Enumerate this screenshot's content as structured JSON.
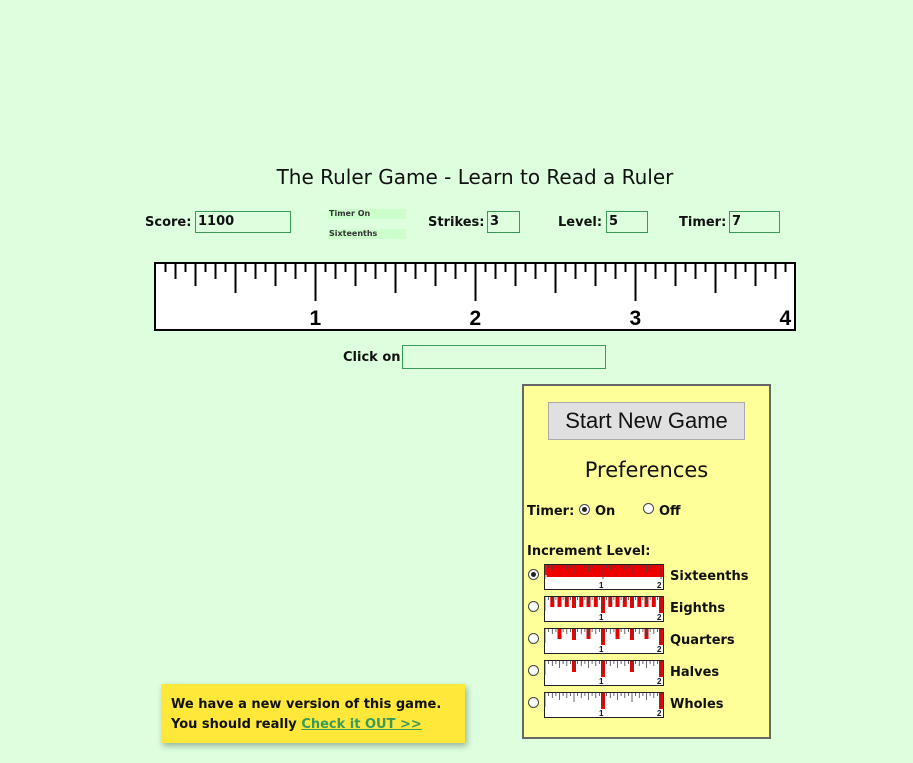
{
  "title": "The Ruler Game - Learn to Read a Ruler",
  "stats": {
    "score_label": "Score:",
    "score_value": "1100",
    "status_timer": "Timer On",
    "status_level": "Sixteenths",
    "strikes_label": "Strikes:",
    "strikes_value": "3",
    "level_label": "Level:",
    "level_value": "5",
    "timer_label": "Timer:",
    "timer_value": "7"
  },
  "ruler": {
    "inches": 4,
    "subdivisions_per_inch": 16,
    "labels": [
      "1",
      "2",
      "3",
      "4"
    ]
  },
  "click_on": {
    "label": "Click on:",
    "value": ""
  },
  "preferences": {
    "start_button": "Start New Game",
    "heading": "Preferences",
    "timer_label": "Timer:",
    "timer_options": [
      {
        "label": "On",
        "selected": true
      },
      {
        "label": "Off",
        "selected": false
      }
    ],
    "increment_label": "Increment Level:",
    "increment_options": [
      {
        "label": "Sixteenths",
        "selected": true,
        "highlight_divisor": 16
      },
      {
        "label": "Eighths",
        "selected": false,
        "highlight_divisor": 8
      },
      {
        "label": "Quarters",
        "selected": false,
        "highlight_divisor": 4
      },
      {
        "label": "Halves",
        "selected": false,
        "highlight_divisor": 2
      },
      {
        "label": "Wholes",
        "selected": false,
        "highlight_divisor": 1
      }
    ],
    "highlight_color": "#ee0000"
  },
  "banner": {
    "line1": "We have a new version of this game.",
    "line2": "You should really ",
    "link": "Check it OUT >>"
  }
}
